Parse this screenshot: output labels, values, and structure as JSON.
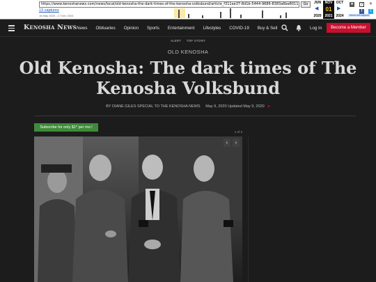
{
  "wayback": {
    "url": "https://www.kenoshanews.com/news/local/old-kenosha-the-dark-times-of-the-kenosha-volksbund/article_f311ee37-8d1b-5444-9686-8383a6be8011.html",
    "go_label": "Go",
    "captures": "13 captures",
    "date_range": "16 May 2020 - 17 Dec 2024",
    "months": [
      "JUN",
      "NOV",
      "OCT"
    ],
    "day": "01",
    "years": [
      "2020",
      "2021",
      "2024"
    ],
    "about": "About this capture"
  },
  "header": {
    "logo": "Kenosha News",
    "nav": [
      "News",
      "Obituaries",
      "Opinion",
      "Sports",
      "Entertainment",
      "Lifestyles",
      "COVID-19",
      "Buy & Sell"
    ],
    "login": "Log In",
    "member": "Become a Member"
  },
  "article": {
    "tags": [
      "ALERT",
      "TOP STORY"
    ],
    "section": "OLD KENOSHA",
    "headline": "Old Kenosha: The dark times of The Kenosha Volksbund",
    "byline": "BY DIANE GILES SPECIAL TO THE KENOSHA NEWS",
    "date": "May 9, 2020",
    "updated": "Updated May 9, 2020",
    "subscribe": "Subscribe for only $1* per mo.!",
    "counter": "1 of 3"
  }
}
